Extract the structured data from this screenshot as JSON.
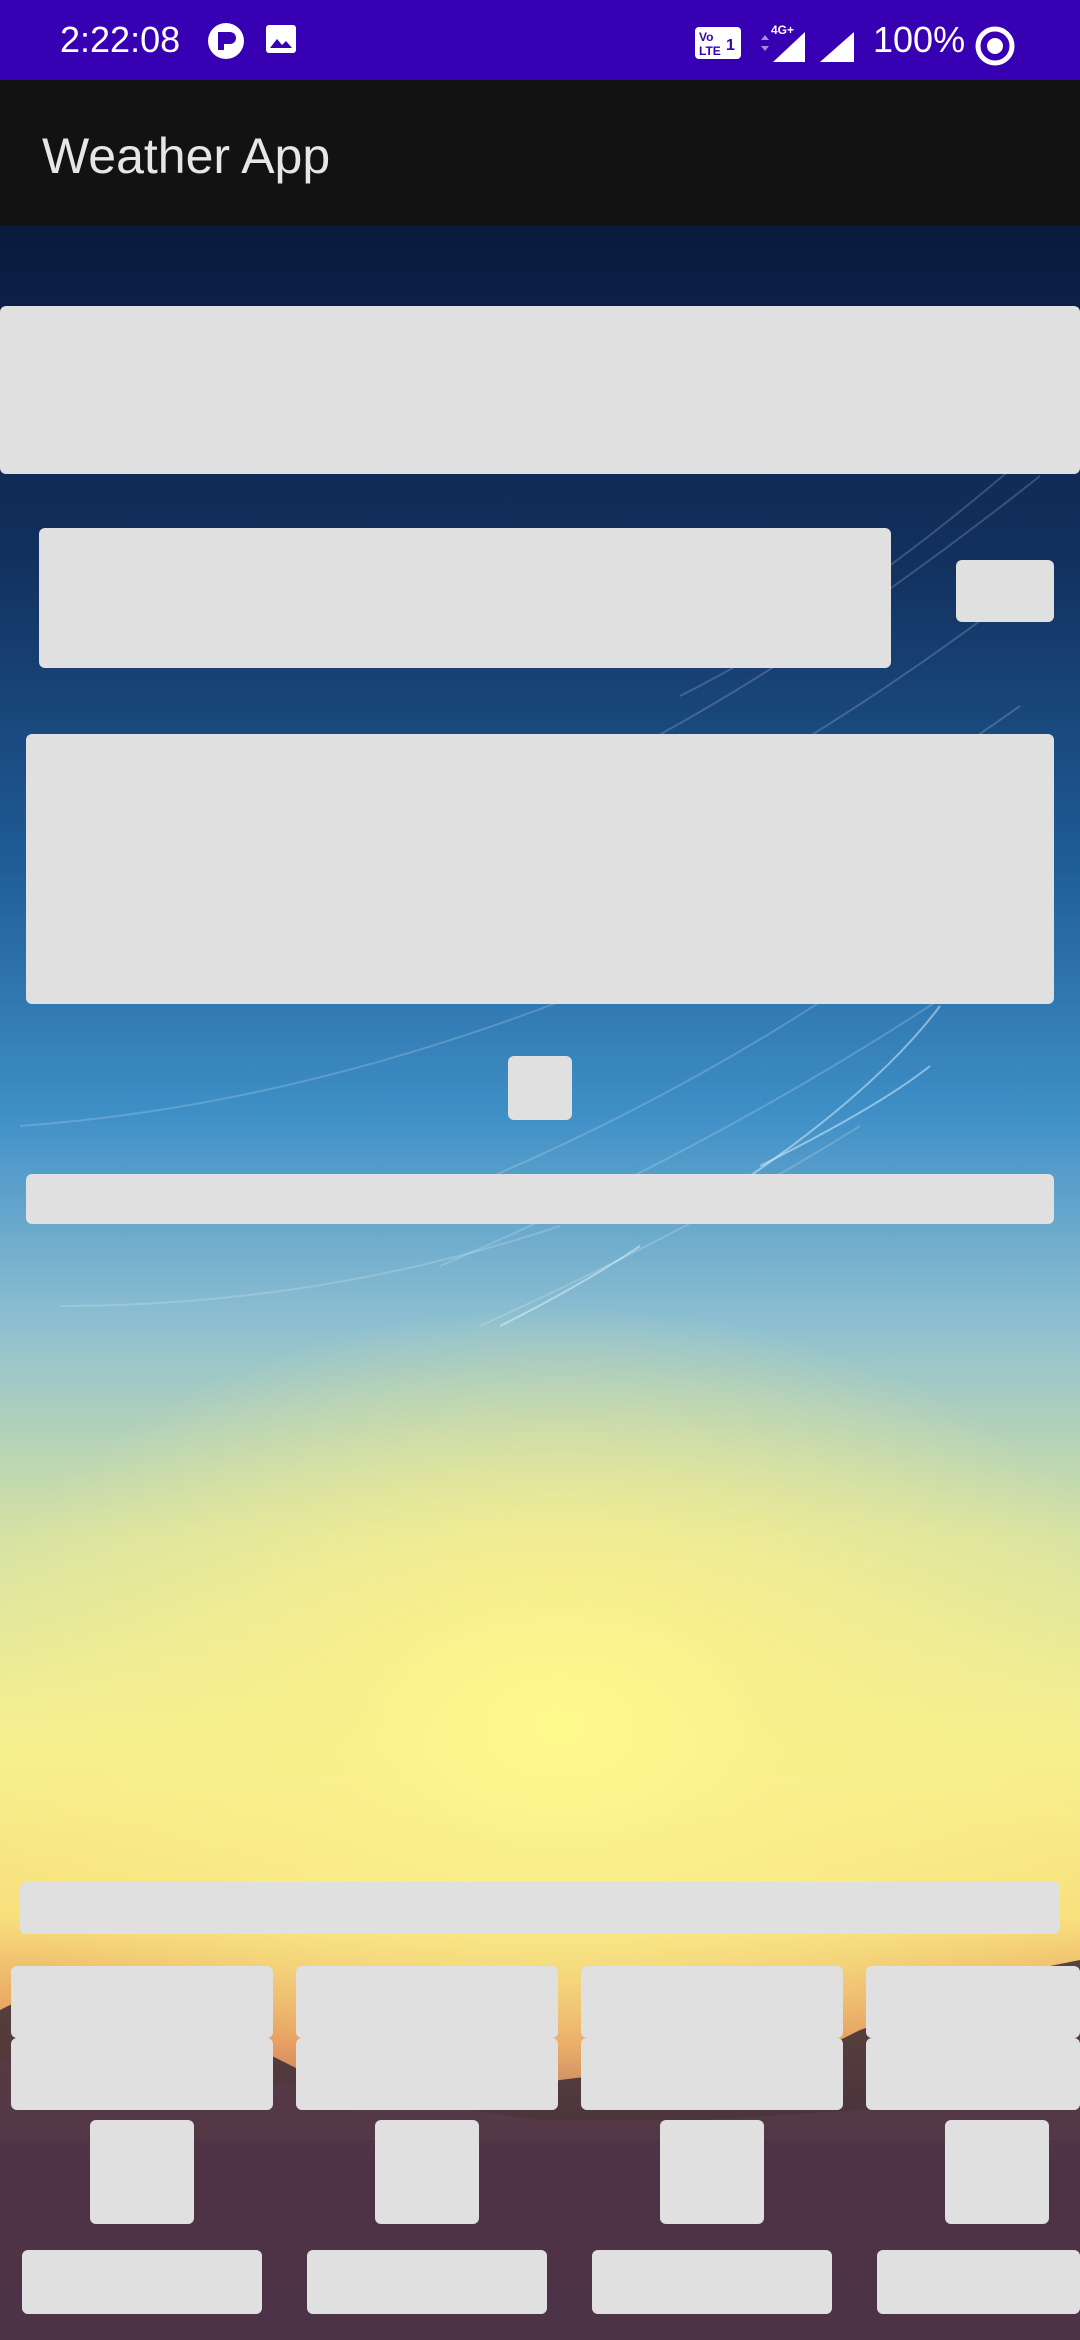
{
  "status_bar": {
    "time": "2:22:08",
    "battery_text": "100%",
    "icons": [
      "rd-app-icon",
      "image-icon",
      "volte-icon",
      "4g-signal-icon",
      "signal-icon",
      "sync-circle-icon"
    ]
  },
  "app_bar": {
    "title": "Weather App"
  },
  "colors": {
    "status_bar": "#3700b3",
    "app_bar": "#121212",
    "placeholder": "#e0e0e0",
    "title_text": "#e6e6e6"
  }
}
